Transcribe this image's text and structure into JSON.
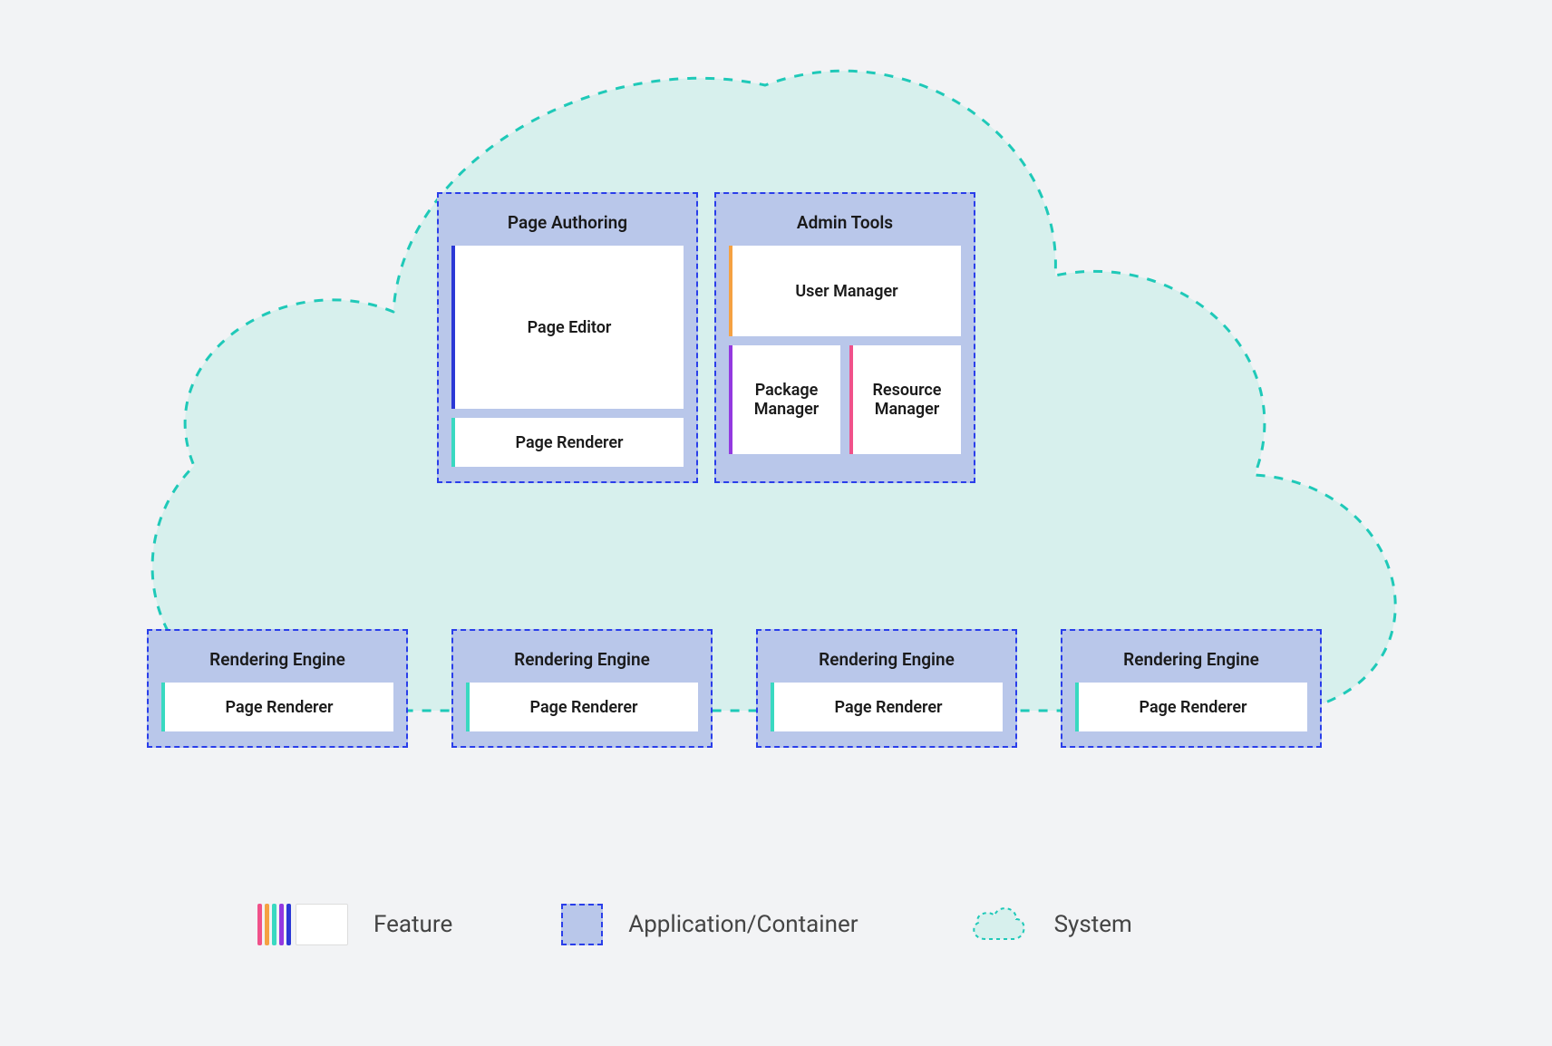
{
  "containers": {
    "page_authoring": {
      "title": "Page Authoring",
      "features": {
        "page_editor": "Page Editor",
        "page_renderer": "Page Renderer"
      }
    },
    "admin_tools": {
      "title": "Admin Tools",
      "features": {
        "user_manager": "User Manager",
        "package_manager": "Package Manager",
        "resource_manager": "Resource Manager"
      }
    },
    "rendering_engine": {
      "title": "Rendering Engine",
      "features": {
        "page_renderer": "Page Renderer"
      }
    }
  },
  "legend": {
    "feature": "Feature",
    "application_container": "Application/Container",
    "system": "System"
  },
  "colors": {
    "system_outline": "#1fc9b8",
    "system_fill": "#d7f0ed",
    "container_outline": "#2a3eea",
    "container_fill": "#b9c7ea",
    "accent_blue": "#2b38d6",
    "accent_teal": "#39d9c1",
    "accent_orange": "#f5a142",
    "accent_purple": "#9339e0",
    "accent_pink": "#f0518a"
  }
}
